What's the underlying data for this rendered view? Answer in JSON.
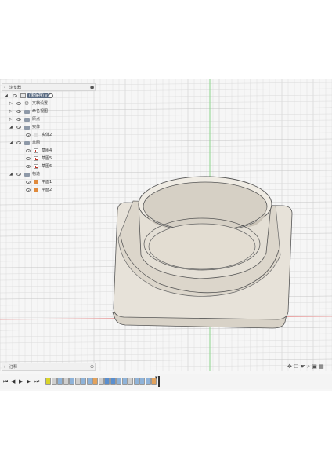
{
  "browser": {
    "title": "浏览器",
    "root": "(未保存) v1",
    "items": [
      {
        "label": "文档设置",
        "level": 1,
        "icon": "gear-icon"
      },
      {
        "label": "命名视图",
        "level": 1,
        "icon": "folder-icon"
      },
      {
        "label": "原点",
        "level": 1,
        "icon": "folder-icon"
      },
      {
        "label": "实体",
        "level": 1,
        "icon": "folder-icon"
      },
      {
        "label": "实体2",
        "level": 2,
        "icon": "body-icon"
      },
      {
        "label": "草图",
        "level": 1,
        "icon": "folder-icon"
      },
      {
        "label": "草图4",
        "level": 2,
        "icon": "sketch-icon"
      },
      {
        "label": "草图5",
        "level": 2,
        "icon": "sketch-icon"
      },
      {
        "label": "草图6",
        "level": 2,
        "icon": "sketch-icon"
      },
      {
        "label": "构造",
        "level": 1,
        "icon": "folder-icon"
      },
      {
        "label": "平面1",
        "level": 2,
        "icon": "plane-icon"
      },
      {
        "label": "平面2",
        "level": 2,
        "icon": "plane-icon"
      }
    ]
  },
  "comments": {
    "title": "注释"
  },
  "colors": {
    "grid_minor": "#dcdcdc",
    "grid_major": "#c6c6c6",
    "axis_green": "#8bd48b",
    "axis_red": "#e9a5a5",
    "model_fill": "#e7e2d9",
    "model_edge": "#555555",
    "root_label_bg": "#5a6b82"
  },
  "nav_tools": [
    "orbit-icon",
    "pan-icon",
    "look-at-icon",
    "zoom-icon",
    "display-settings-icon",
    "grid-settings-icon"
  ],
  "timeline": {
    "playback": [
      "skip-to-start-icon",
      "step-back-icon",
      "play-icon",
      "step-forward-icon",
      "skip-to-end-icon"
    ],
    "features": [
      {
        "name": "sketch",
        "color": "#d9d42a"
      },
      {
        "name": "sketch",
        "color": "#cfcfcf"
      },
      {
        "name": "extrude",
        "color": "#8fb3d9"
      },
      {
        "name": "sketch",
        "color": "#cfcfcf"
      },
      {
        "name": "extrude",
        "color": "#8fb3d9"
      },
      {
        "name": "sketch",
        "color": "#cfcfcf"
      },
      {
        "name": "revolve",
        "color": "#8fb3d9"
      },
      {
        "name": "fillet",
        "color": "#8fb3d9"
      },
      {
        "name": "plane",
        "color": "#e3a25c"
      },
      {
        "name": "sketch",
        "color": "#cfcfcf"
      },
      {
        "name": "extrude",
        "color": "#5a8fcf"
      },
      {
        "name": "extrude",
        "color": "#5a8fcf"
      },
      {
        "name": "fillet",
        "color": "#8fb3d9"
      },
      {
        "name": "fillet",
        "color": "#8fb3d9"
      },
      {
        "name": "sketch",
        "color": "#cfcfcf"
      },
      {
        "name": "shell",
        "color": "#8fb3d9"
      },
      {
        "name": "fillet",
        "color": "#8fb3d9"
      },
      {
        "name": "fillet",
        "color": "#8fb3d9"
      },
      {
        "name": "plane",
        "color": "#e3a25c"
      }
    ]
  }
}
